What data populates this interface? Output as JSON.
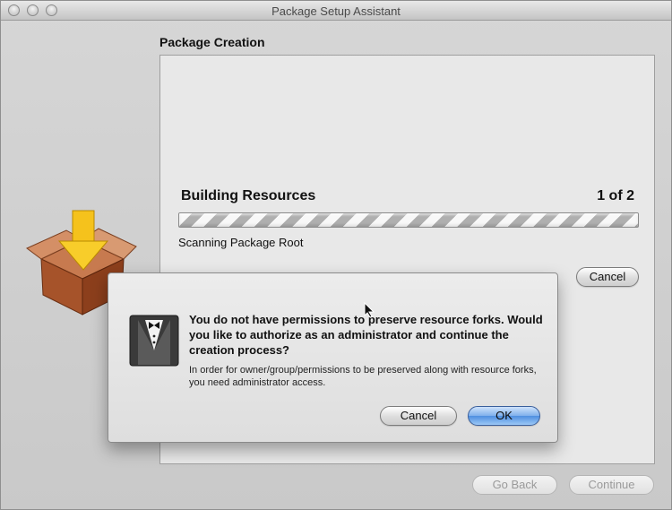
{
  "window": {
    "title": "Package Setup Assistant"
  },
  "main": {
    "section_title": "Package Creation",
    "build_title": "Building Resources",
    "build_count": "1 of 2",
    "status": "Scanning Package Root",
    "cancel_label": "Cancel",
    "progress": {
      "indeterminate": true
    }
  },
  "footer": {
    "go_back_label": "Go Back",
    "continue_label": "Continue"
  },
  "dialog": {
    "heading": "You do not have permissions to preserve resource forks. Would you like to authorize as an administrator and continue the creation process?",
    "body": "In order for owner/group/permissions to be preserved along with resource forks, you need administrator access.",
    "cancel_label": "Cancel",
    "ok_label": "OK"
  },
  "icons": {
    "package": "package-icon",
    "dialog": "tuxedo-icon",
    "cursor": "mouse-cursor-icon"
  },
  "colors": {
    "default_button": "#4f8fe0",
    "window_bg": "#d6d6d6"
  }
}
